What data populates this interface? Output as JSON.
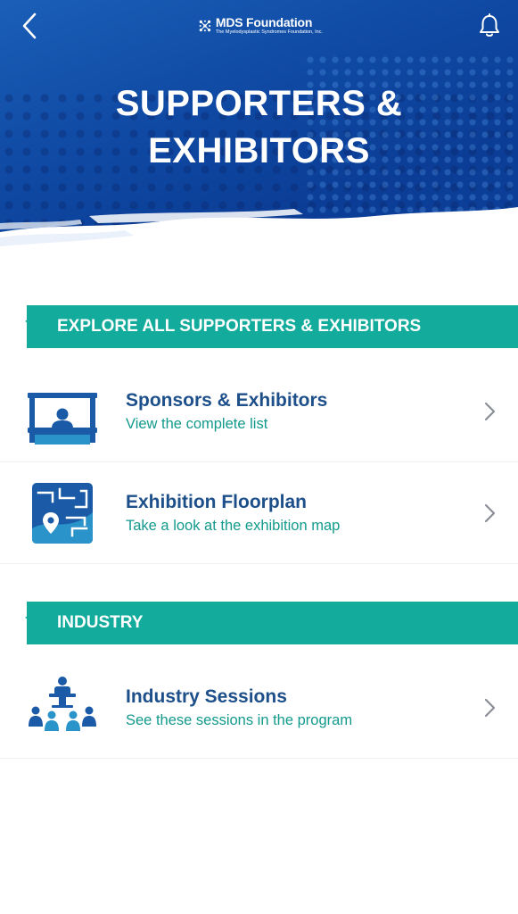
{
  "header": {
    "logo_name": "MDS Foundation",
    "logo_subtitle": "The Myelodysplastic Syndromes Foundation, Inc.",
    "title_line1": "SUPPORTERS &",
    "title_line2": "EXHIBITORS",
    "back_icon": "chevron-left-icon",
    "bell_icon": "bell-icon"
  },
  "colors": {
    "header_blue": "#0f49a3",
    "teal": "#13ab9b",
    "title_blue": "#1d4f8a",
    "subtitle_teal": "#139a8c",
    "chevron_gray": "#8a8f96"
  },
  "sections": [
    {
      "title": "EXPLORE ALL SUPPORTERS & EXHIBITORS",
      "items": [
        {
          "title": "Sponsors & Exhibitors",
          "subtitle": "View the complete list",
          "icon": "exhibitor-booth-icon"
        },
        {
          "title": "Exhibition Floorplan",
          "subtitle": "Take a look at the exhibition map",
          "icon": "floorplan-map-icon"
        }
      ]
    },
    {
      "title": "INDUSTRY",
      "items": [
        {
          "title": "Industry Sessions",
          "subtitle": "See these sessions in the program",
          "icon": "audience-speaker-icon"
        }
      ]
    }
  ]
}
